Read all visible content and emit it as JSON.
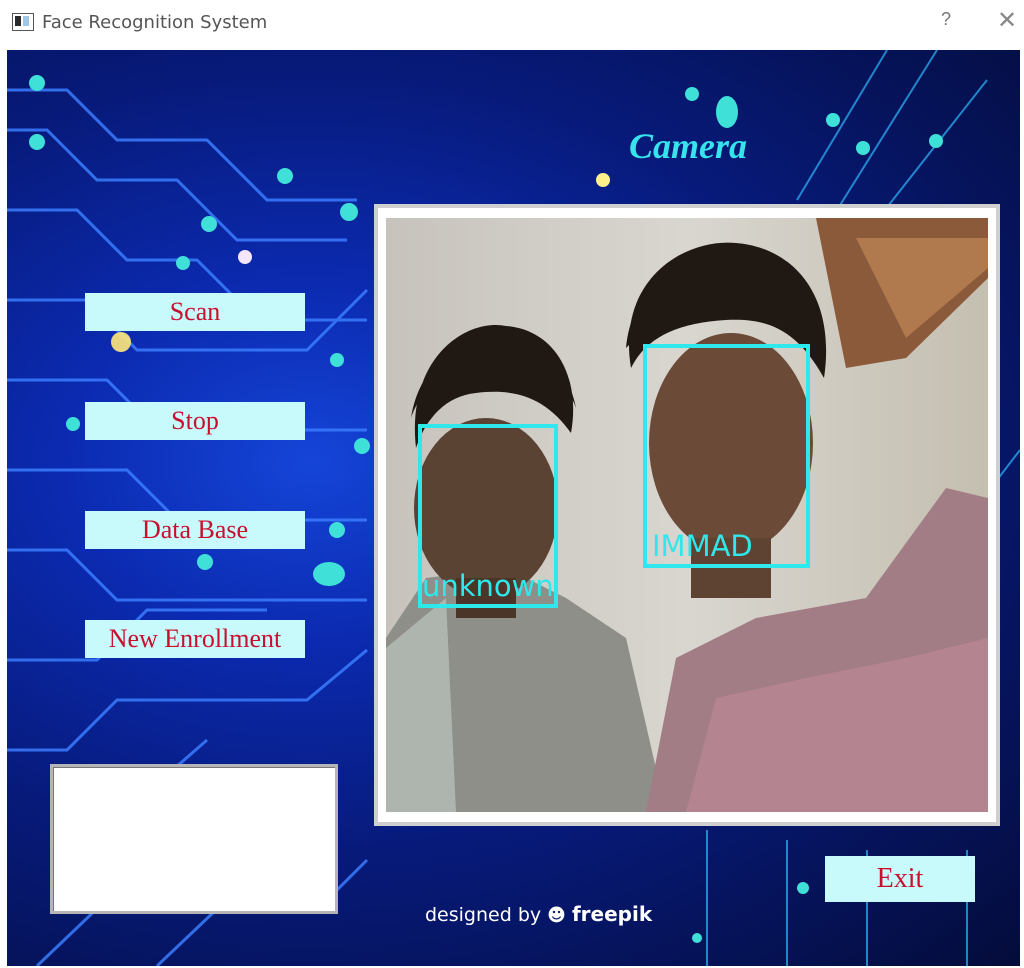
{
  "window": {
    "title": "Face Recognition System",
    "help_glyph": "?",
    "close_glyph": "✕"
  },
  "panel": {
    "camera_title": "Camera"
  },
  "sidebar": {
    "buttons": [
      {
        "label": "Scan"
      },
      {
        "label": "Stop"
      },
      {
        "label": "Data Base"
      },
      {
        "label": "New Enrollment"
      }
    ],
    "status_text": ""
  },
  "camera": {
    "faces": [
      {
        "label": "unknown"
      },
      {
        "label": "IMMAD"
      }
    ]
  },
  "footer": {
    "exit_label": "Exit",
    "credit_prefix": "designed by",
    "credit_logo": "☻",
    "credit_brand": "freepik"
  },
  "colors": {
    "button_bg": "#c8f9fb",
    "button_text": "#c8102e",
    "accent_cyan": "#36e4ec",
    "face_box": "#2fe8ec"
  },
  "icons": {
    "app": "window-app-icon",
    "help": "help-icon",
    "close": "close-icon"
  }
}
